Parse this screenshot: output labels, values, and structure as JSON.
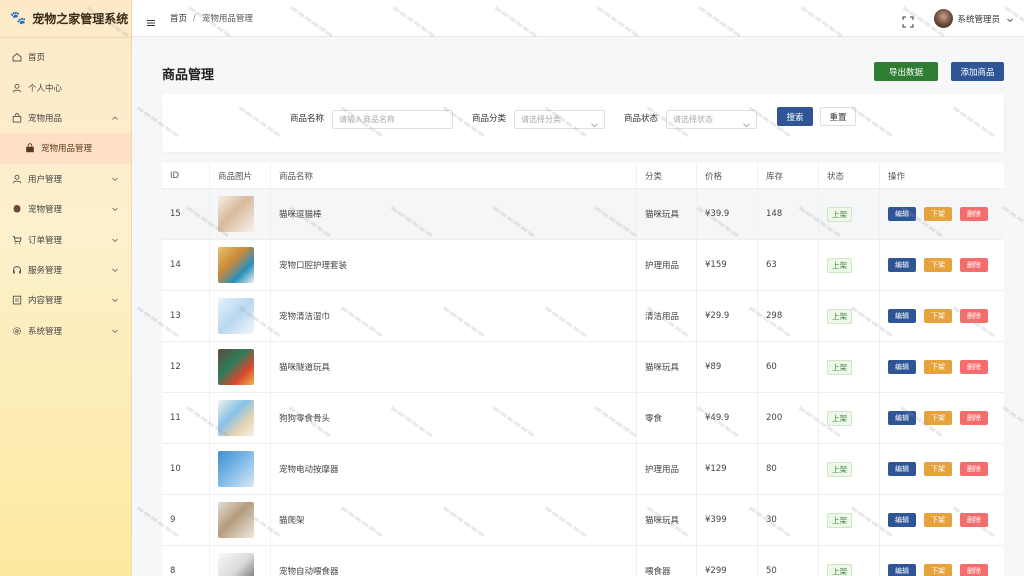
{
  "app": {
    "title": "宠物之家管理系统"
  },
  "sidebar": {
    "items": [
      {
        "label": "首页",
        "icon": "home-icon",
        "expandable": false
      },
      {
        "label": "个人中心",
        "icon": "user-icon",
        "expandable": false
      },
      {
        "label": "宠物用品",
        "icon": "bag-icon",
        "expandable": true,
        "expanded": true
      },
      {
        "label": "宠物用品管理",
        "icon": "bag-filled-icon",
        "sub": true,
        "active": true
      },
      {
        "label": "用户管理",
        "icon": "user-icon",
        "expandable": true
      },
      {
        "label": "宠物管理",
        "icon": "paw-icon",
        "expandable": true
      },
      {
        "label": "订单管理",
        "icon": "cart-icon",
        "expandable": true
      },
      {
        "label": "服务管理",
        "icon": "headset-icon",
        "expandable": true
      },
      {
        "label": "内容管理",
        "icon": "document-icon",
        "expandable": true
      },
      {
        "label": "系统管理",
        "icon": "gear-icon",
        "expandable": true
      }
    ]
  },
  "header": {
    "breadcrumb": {
      "home": "首页",
      "separator": "/",
      "current": "宠物用品管理"
    },
    "user": {
      "name": "系统管理员"
    }
  },
  "page": {
    "title": "商品管理",
    "export_label": "导出数据",
    "add_label": "添加商品"
  },
  "search": {
    "name_label": "商品名称",
    "name_placeholder": "请输入商品名称",
    "category_label": "商品分类",
    "category_placeholder": "请选择分类",
    "status_label": "商品状态",
    "status_placeholder": "请选择状态",
    "search_label": "搜索",
    "reset_label": "重置"
  },
  "table": {
    "headers": [
      "ID",
      "商品图片",
      "商品名称",
      "分类",
      "价格",
      "库存",
      "状态",
      "操作"
    ],
    "actions": {
      "edit": "编辑",
      "off": "下架",
      "delete": "删除"
    },
    "rows": [
      {
        "id": "15",
        "name": "猫咪逗猫棒",
        "category": "猫咪玩具",
        "price": "¥39.9",
        "stock": "148",
        "status": "上架",
        "thumb": "cat-teaser"
      },
      {
        "id": "14",
        "name": "宠物口腔护理套装",
        "category": "护理用品",
        "price": "¥159",
        "stock": "63",
        "status": "上架",
        "thumb": "dental-kit"
      },
      {
        "id": "13",
        "name": "宠物清洁湿巾",
        "category": "清洁用品",
        "price": "¥29.9",
        "stock": "298",
        "status": "上架",
        "thumb": "wipes"
      },
      {
        "id": "12",
        "name": "猫咪隧道玩具",
        "category": "猫咪玩具",
        "price": "¥89",
        "stock": "60",
        "status": "上架",
        "thumb": "tunnel"
      },
      {
        "id": "11",
        "name": "狗狗零食骨头",
        "category": "零食",
        "price": "¥49.9",
        "stock": "200",
        "status": "上架",
        "thumb": "bones"
      },
      {
        "id": "10",
        "name": "宠物电动按摩器",
        "category": "护理用品",
        "price": "¥129",
        "stock": "80",
        "status": "上架",
        "thumb": "massager"
      },
      {
        "id": "9",
        "name": "猫爬架",
        "category": "猫咪玩具",
        "price": "¥399",
        "stock": "30",
        "status": "上架",
        "thumb": "cat-tree"
      },
      {
        "id": "8",
        "name": "宠物自动喂食器",
        "category": "喂食器",
        "price": "¥299",
        "stock": "50",
        "status": "上架",
        "thumb": "feeder"
      }
    ]
  },
  "colors": {
    "primary": "#2f5597",
    "export": "#2f7d32",
    "warning": "#e6a23c",
    "danger": "#f56c6c",
    "success_tag": "#3b8a3e"
  }
}
